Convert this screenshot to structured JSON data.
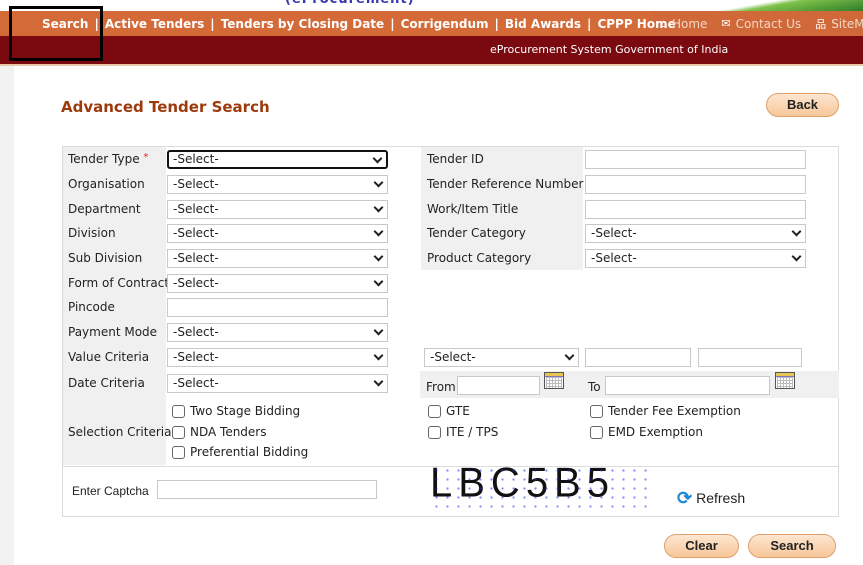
{
  "header": {
    "subtitle": "(eProcurement)",
    "nav_links": [
      "Search",
      "Active Tenders",
      "Tenders by Closing Date",
      "Corrigendum",
      "Bid Awards",
      "CPPP Home"
    ],
    "nav_separator": "|",
    "right_links": [
      {
        "icon": "home-icon",
        "glyph": "⌂",
        "label": "Home"
      },
      {
        "icon": "mail-icon",
        "glyph": "✉",
        "label": "Contact Us"
      },
      {
        "icon": "sitemap-icon",
        "glyph": "品",
        "label": "SiteMap"
      }
    ],
    "tagline": "eProcurement System Government of India"
  },
  "page": {
    "title": "Advanced Tender Search",
    "back_label": "Back"
  },
  "form": {
    "left_fields": [
      {
        "label": "Tender Type",
        "required": "*",
        "type": "select",
        "value": "-Select-"
      },
      {
        "label": "Organisation",
        "type": "select",
        "value": "-Select-"
      },
      {
        "label": "Department",
        "type": "select",
        "value": "-Select-"
      },
      {
        "label": "Division",
        "type": "select",
        "value": "-Select-"
      },
      {
        "label": "Sub Division",
        "type": "select",
        "value": "-Select-"
      },
      {
        "label": "Form of Contract",
        "type": "select",
        "value": "-Select-"
      },
      {
        "label": "Pincode",
        "type": "text",
        "value": ""
      },
      {
        "label": "Payment Mode",
        "type": "select",
        "value": "-Select-"
      },
      {
        "label": "Value Criteria",
        "type": "select",
        "value": "-Select-"
      },
      {
        "label": "Date Criteria",
        "type": "select",
        "value": "-Select-"
      }
    ],
    "right_fields": [
      {
        "label": "Tender ID",
        "type": "text",
        "value": ""
      },
      {
        "label": "Tender Reference Number",
        "type": "text",
        "value": ""
      },
      {
        "label": "Work/Item Title",
        "type": "text",
        "value": ""
      },
      {
        "label": "Tender Category",
        "type": "select",
        "value": "-Select-"
      },
      {
        "label": "Product Category",
        "type": "select",
        "value": "-Select-"
      }
    ],
    "value_criteria_operator": "-Select-",
    "value_from": "",
    "value_to": "",
    "date_from_label": "From",
    "date_to_label": "To",
    "date_from": "",
    "date_to": "",
    "selection_criteria_label": "Selection Criteria",
    "checkboxes_col1": [
      "Two Stage Bidding",
      "NDA Tenders",
      "Preferential Bidding"
    ],
    "checkboxes_col2": [
      "GTE",
      "ITE / TPS"
    ],
    "checkboxes_col3": [
      "Tender Fee Exemption",
      "EMD Exemption"
    ],
    "captcha_label": "Enter Captcha",
    "captcha_value": "",
    "captcha_image_text": "LBC5B5",
    "refresh_label": "Refresh"
  },
  "actions": {
    "clear_label": "Clear",
    "search_label": "Search"
  },
  "colors": {
    "nav_orange": "#d46a38",
    "banner_maroon": "#7a0a10",
    "title_brown": "#9c3a0c",
    "button_peach": "#f7c79a"
  }
}
